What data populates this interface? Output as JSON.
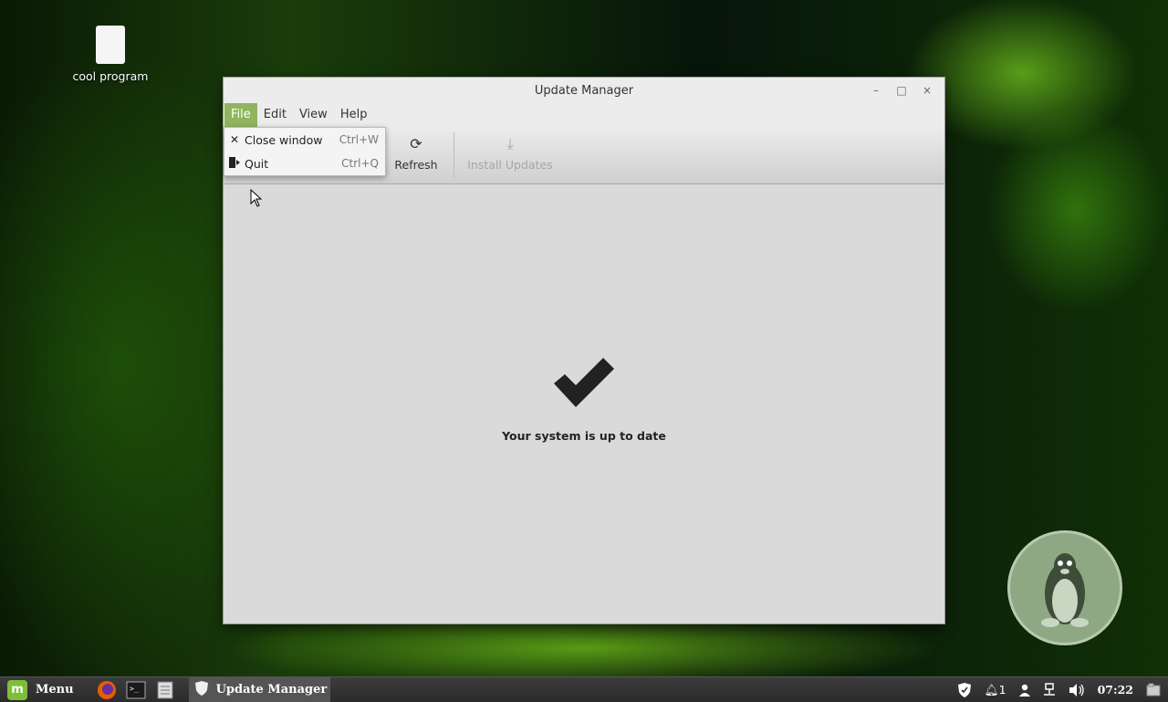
{
  "desktop": {
    "icons": [
      {
        "label": "cool program",
        "icon": "file-icon"
      }
    ]
  },
  "window": {
    "title": "Update Manager",
    "controls": {
      "minimize": "–",
      "maximize": "□",
      "close": "×"
    }
  },
  "menubar": {
    "items": [
      "File",
      "Edit",
      "View",
      "Help"
    ],
    "active": "File"
  },
  "file_menu": {
    "items": [
      {
        "icon": "close-icon",
        "label": "Close window",
        "accel": "Ctrl+W"
      },
      {
        "icon": "quit-icon",
        "label": "Quit",
        "accel": "Ctrl+Q"
      }
    ]
  },
  "toolbar": {
    "refresh_label": "Refresh",
    "install_label": "Install Updates"
  },
  "main": {
    "status_message": "Your system is up to date",
    "status_icon": "checkmark-icon"
  },
  "taskbar": {
    "menu_label": "Menu",
    "launchers": [
      "firefox-icon",
      "terminal-icon",
      "files-icon"
    ],
    "window_label": "Update Manager",
    "tray": {
      "notifications": "1",
      "clock": "07:22"
    }
  },
  "colors": {
    "menu_highlight": "#8fb55e",
    "mint_green": "#7cbf3a"
  }
}
